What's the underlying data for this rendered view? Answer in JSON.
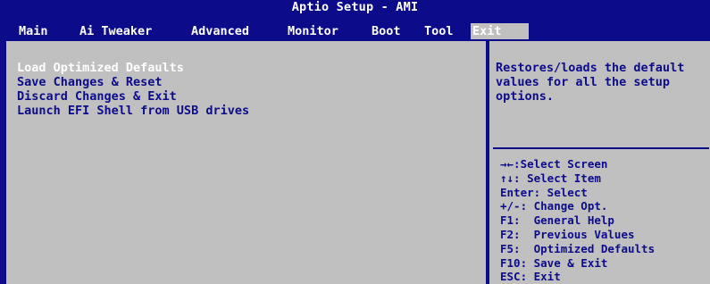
{
  "title": "Aptio Setup - AMI",
  "tabs": [
    {
      "label": "Main"
    },
    {
      "label": "Ai Tweaker"
    },
    {
      "label": "Advanced"
    },
    {
      "label": "Monitor"
    },
    {
      "label": "Boot"
    },
    {
      "label": "Tool"
    },
    {
      "label": "Exit",
      "active": true
    }
  ],
  "options": [
    {
      "label": "Load Optimized Defaults",
      "selected": true
    },
    {
      "label": "Save Changes & Reset"
    },
    {
      "label": "Discard Changes & Exit"
    },
    {
      "label": "Launch EFI Shell from USB drives"
    }
  ],
  "help": {
    "description": "Restores/loads the default values for all the setup options."
  },
  "keys": [
    {
      "text": "→←:Select Screen"
    },
    {
      "text": "↑↓: Select Item"
    },
    {
      "text": "Enter: Select"
    },
    {
      "text": "+/-: Change Opt."
    },
    {
      "text": "F1:  General Help"
    },
    {
      "text": "F2:  Previous Values"
    },
    {
      "text": "F5:  Optimized Defaults"
    },
    {
      "text": "F10: Save & Exit"
    },
    {
      "text": "ESC: Exit"
    }
  ],
  "colors": {
    "background": "#0c0c8a",
    "panel": "#c0c0c0",
    "text": "#0c0c8a",
    "highlight": "#ffffff"
  }
}
